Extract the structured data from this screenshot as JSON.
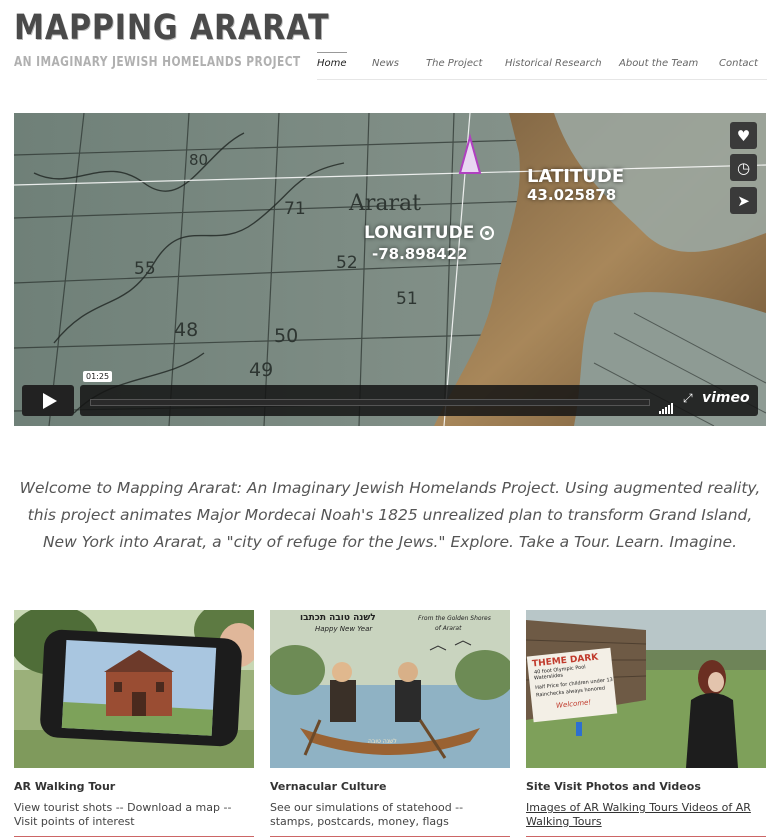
{
  "header": {
    "title": "MAPPING ARARAT",
    "tagline": "AN IMAGINARY JEWISH HOMELANDS PROJECT"
  },
  "nav": {
    "items": [
      {
        "label": "Home",
        "active": true
      },
      {
        "label": "News",
        "active": false
      },
      {
        "label": "The Project",
        "active": false
      },
      {
        "label": "Historical Research",
        "active": false
      },
      {
        "label": "About the Team",
        "active": false
      },
      {
        "label": "Contact",
        "active": false
      }
    ]
  },
  "video": {
    "map_numbers": [
      "80",
      "71",
      "55",
      "52",
      "51",
      "48",
      "50",
      "49"
    ],
    "map_place": "Ararat",
    "latitude_label": "LATITUDE",
    "latitude_value": "43.025878",
    "longitude_label": "LONGITUDE",
    "longitude_value": "-78.898422",
    "timecode": "01:25",
    "progress": 0.0,
    "player_brand": "vimeo",
    "side_buttons": [
      "heart-icon",
      "clock-icon",
      "send-icon"
    ]
  },
  "welcome": {
    "text": "Welcome to Mapping Ararat: An Imaginary Jewish Homelands Project. Using augmented reality, this project animates Major Mordecai Noah's 1825 unrealized plan to transform Grand Island, New York into Ararat, a \"city of refuge for the Jews.\" Explore. Take a Tour. Learn. Imagine."
  },
  "cards": [
    {
      "title": "AR Walking Tour",
      "desc": "View tourist shots -- Download a map -- Visit points of interest",
      "is_link": false
    },
    {
      "title": "Vernacular Culture",
      "desc": "See our simulations of statehood -- stamps, postcards, money, flags",
      "is_link": false,
      "image_text": [
        "לשנה טובה תכתבו",
        "Happy New Year",
        "From the Golden Shores",
        "of Ararat",
        "לשנה טובה"
      ]
    },
    {
      "title": "Site Visit Photos and Videos",
      "desc": "Images of AR Walking Tours Videos of AR Walking Tours",
      "is_link": true,
      "image_text": [
        "THEME DARK",
        "40 foot Olympic Pool",
        "Waterslides",
        "Half Price for children under 13",
        "Rainchecks always honored",
        "Welcome!"
      ]
    }
  ],
  "colors": {
    "accent_rule": "#cc6666",
    "title_gray": "#4a4a4a"
  }
}
